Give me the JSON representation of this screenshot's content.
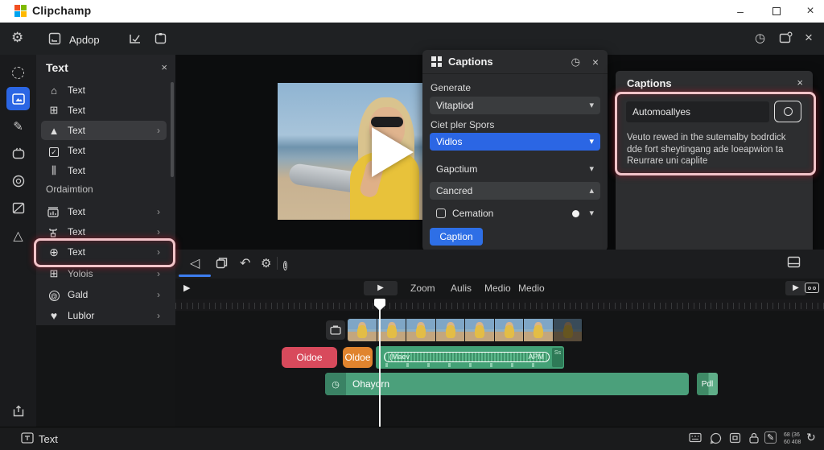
{
  "titlebar": {
    "app_name": "Clipchamp"
  },
  "toolbar": {
    "project_label": "Apdop"
  },
  "text_panel": {
    "title": "Text",
    "items": [
      {
        "label": "Text"
      },
      {
        "label": "Text"
      },
      {
        "label": "Text"
      },
      {
        "label": "Text"
      },
      {
        "label": "Text"
      }
    ],
    "section_label": "Ordaimtion",
    "section_items": [
      {
        "label": "Text"
      },
      {
        "label": "Text"
      },
      {
        "label": "Text"
      },
      {
        "label": "Yolois"
      },
      {
        "label": "Gald"
      },
      {
        "label": "Lublor"
      }
    ]
  },
  "captions_popup": {
    "title": "Captions",
    "generate_label": "Generate",
    "language_value": "Vitaptiod",
    "speaker_label": "Ciet pler Spors",
    "filter_value": "Vidlos",
    "row_caption_style": "Gapctium",
    "row_cancel": "Cancred",
    "checkbox_label": "Cemation",
    "submit_label": "Caption"
  },
  "captions_panel": {
    "title": "Captions",
    "input_value": "Automoallyes",
    "description": "Veuto rewed in the sutemalby bodrdick dde fort sheytingang ade loeapwion ta Reurrare uni caplite"
  },
  "timeline": {
    "labels": [
      "Zoom",
      "Aulis",
      "Medio",
      "Medio"
    ],
    "clips": {
      "red_label": "Oidoe",
      "orange_label": "Oldoe",
      "audio_label": "(Maev",
      "audio_right_label": "APM",
      "audio_tail_label": "Ss",
      "main_label": "Ohayorn",
      "small_label": "Pdl"
    }
  },
  "statusbar": {
    "left_label": "Text",
    "timecode_top": "68 (36",
    "timecode_bottom": "60 408"
  },
  "icons": {
    "minimize": "–",
    "close": "×",
    "gear": "⚙",
    "play": "▶",
    "back": "◁",
    "undo": "↶",
    "chevron_down": "▾",
    "chevron_up": "▴",
    "chevron_right": "›",
    "clock": "◷",
    "heart": "♥",
    "at": "@",
    "triangle": "△",
    "home": "⌂",
    "plus_box": "⊞",
    "arrow_up": "▲",
    "check": "✓",
    "circled_plus": "⊕",
    "info": "!",
    "pencil": "✎",
    "bars": "⫼",
    "flow": "⌁",
    "loop": "↻"
  },
  "colors": {
    "accent_blue": "#2b66e4",
    "annotation_pink": "#f2c3c8",
    "clip_red": "#d84a5c",
    "clip_orange": "#e0842e",
    "clip_green": "#4ba07b"
  }
}
